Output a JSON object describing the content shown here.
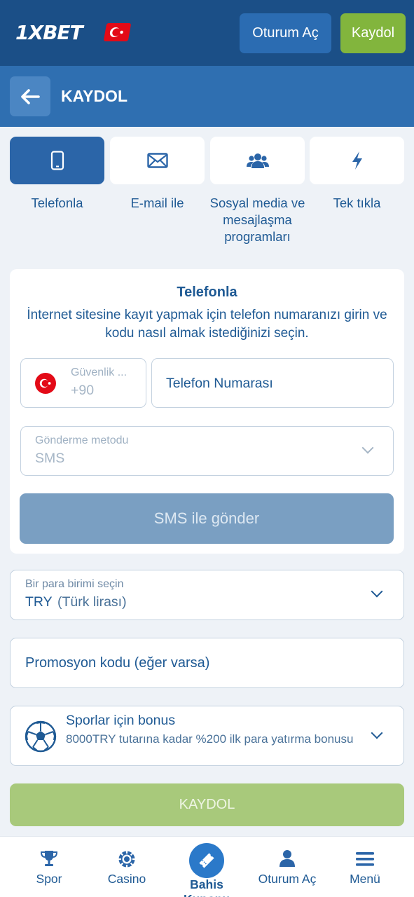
{
  "header": {
    "logo_text": "1XBET",
    "login_label": "Oturum Aç",
    "register_label": "Kaydol"
  },
  "subheader": {
    "title": "KAYDOL"
  },
  "methods": [
    {
      "label": "Telefonla",
      "icon": "phone-icon",
      "active": true
    },
    {
      "label": "E-mail ile",
      "icon": "mail-icon",
      "active": false
    },
    {
      "label": "Sosyal media ve mesajlaşma programları",
      "icon": "users-icon",
      "active": false
    },
    {
      "label": "Tek tıkla",
      "icon": "lightning-icon",
      "active": false
    }
  ],
  "card": {
    "title": "Telefonla",
    "description": "İnternet sitesine kayıt yapmak için telefon numaranızı girin ve kodu nasıl almak istediğinizi seçin.",
    "country_label": "Güvenlik ...",
    "country_code": "+90",
    "phone_placeholder": "Telefon Numarası",
    "method_label": "Gönderme metodu",
    "method_value": "SMS",
    "send_button": "SMS ile gönder"
  },
  "currency": {
    "label": "Bir para birimi seçin",
    "code": "TRY",
    "name": "(Türk lirası)"
  },
  "promo": {
    "placeholder": "Promosyon kodu (eğer varsa)"
  },
  "bonus": {
    "title": "Sporlar için bonus",
    "description": "8000TRY tutarına kadar %200 ilk para yatırma bonusu"
  },
  "submit_label": "KAYDOL",
  "bottom_nav": [
    {
      "label": "Spor",
      "icon": "trophy-icon"
    },
    {
      "label": "Casino",
      "icon": "casino-chip-icon"
    },
    {
      "label": "Bahis Kuponu",
      "icon": "ticket-icon"
    },
    {
      "label": "Oturum Aç",
      "icon": "user-icon"
    },
    {
      "label": "Menü",
      "icon": "menu-icon"
    }
  ],
  "colors": {
    "header_bg": "#1b4f87",
    "subheader_bg": "#2f6fb1",
    "register_green": "#82b53d",
    "active_tab": "#2b65a8"
  }
}
